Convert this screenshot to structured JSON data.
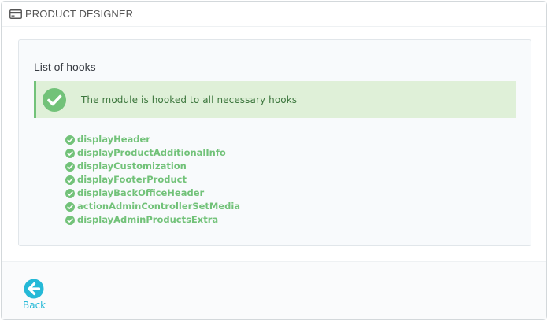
{
  "header": {
    "icon": "credit-card-icon",
    "title": "PRODUCT DESIGNER"
  },
  "hooks_panel": {
    "title": "List of hooks",
    "alert": {
      "icon": "check-circle-icon",
      "message": "The module is hooked to all necessary hooks"
    },
    "hooks": [
      "displayHeader",
      "displayProductAdditionalInfo",
      "displayCustomization",
      "displayFooterProduct",
      "displayBackOfficeHeader",
      "actionAdminControllerSetMedia",
      "displayAdminProductsExtra"
    ]
  },
  "footer": {
    "back_icon": "arrow-left-circle-icon",
    "back_label": "Back"
  },
  "colors": {
    "success_green": "#72c279",
    "success_bg": "#dff0d8",
    "success_text": "#3c763d",
    "link_blue": "#25b9d7"
  }
}
